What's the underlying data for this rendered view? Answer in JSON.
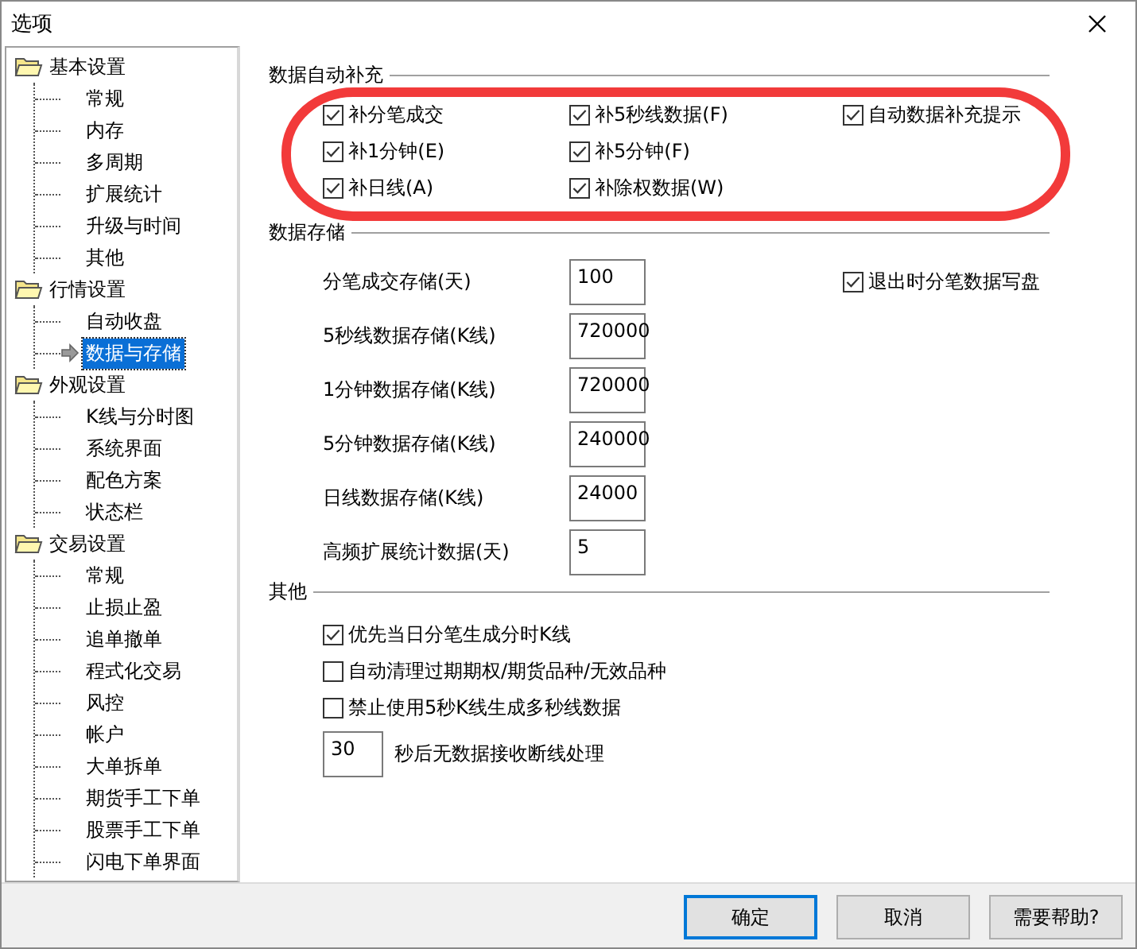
{
  "window": {
    "title": "选项"
  },
  "tree": [
    {
      "label": "基本设置",
      "children": [
        {
          "label": "常规",
          "selected": false
        },
        {
          "label": "内存",
          "selected": false
        },
        {
          "label": "多周期",
          "selected": false
        },
        {
          "label": "扩展统计",
          "selected": false
        },
        {
          "label": "升级与时间",
          "selected": false
        },
        {
          "label": "其他",
          "selected": false
        }
      ]
    },
    {
      "label": "行情设置",
      "children": [
        {
          "label": "自动收盘",
          "selected": false
        },
        {
          "label": "数据与存储",
          "selected": true
        }
      ]
    },
    {
      "label": "外观设置",
      "children": [
        {
          "label": "K线与分时图",
          "selected": false
        },
        {
          "label": "系统界面",
          "selected": false
        },
        {
          "label": "配色方案",
          "selected": false
        },
        {
          "label": "状态栏",
          "selected": false
        }
      ]
    },
    {
      "label": "交易设置",
      "children": [
        {
          "label": "常规",
          "selected": false
        },
        {
          "label": "止损止盈",
          "selected": false
        },
        {
          "label": "追单撤单",
          "selected": false
        },
        {
          "label": "程式化交易",
          "selected": false
        },
        {
          "label": "风控",
          "selected": false
        },
        {
          "label": "帐户",
          "selected": false
        },
        {
          "label": "大单拆单",
          "selected": false
        },
        {
          "label": "期货手工下单",
          "selected": false
        },
        {
          "label": "股票手工下单",
          "selected": false
        },
        {
          "label": "闪电下单界面",
          "selected": false
        }
      ]
    }
  ],
  "auto_fill": {
    "title": "数据自动补充",
    "columns": [
      [
        {
          "label": "补分笔成交",
          "checked": true
        },
        {
          "label": "补1分钟(E)",
          "checked": true
        },
        {
          "label": "补日线(A)",
          "checked": true
        }
      ],
      [
        {
          "label": "补5秒线数据(F)",
          "checked": true
        },
        {
          "label": "补5分钟(F)",
          "checked": true
        },
        {
          "label": "补除权数据(W)",
          "checked": true
        }
      ],
      [
        {
          "label": "自动数据补充提示",
          "checked": true
        }
      ]
    ]
  },
  "storage": {
    "title": "数据存储",
    "fields": [
      {
        "label": "分笔成交存储(天)",
        "value": "100"
      },
      {
        "label": "5秒线数据存储(K线)",
        "value": "720000"
      },
      {
        "label": "1分钟数据存储(K线)",
        "value": "720000"
      },
      {
        "label": "5分钟数据存储(K线)",
        "value": "240000"
      },
      {
        "label": "日线数据存储(K线)",
        "value": "24000"
      },
      {
        "label": "高频扩展统计数据(天)",
        "value": "5"
      }
    ],
    "option": {
      "label": "退出时分笔数据写盘",
      "checked": true
    }
  },
  "other": {
    "title": "其他",
    "options": [
      {
        "label": "优先当日分笔生成分时K线",
        "checked": true
      },
      {
        "label": "自动清理过期期权/期货品种/无效品种",
        "checked": false
      },
      {
        "label": "禁止使用5秒K线生成多秒线数据",
        "checked": false
      }
    ],
    "timeout": {
      "value": "30",
      "label": "秒后无数据接收断线处理"
    }
  },
  "buttons": [
    {
      "label": "确定",
      "default": true
    },
    {
      "label": "取消",
      "default": false
    },
    {
      "label": "需要帮助?",
      "default": false
    }
  ]
}
